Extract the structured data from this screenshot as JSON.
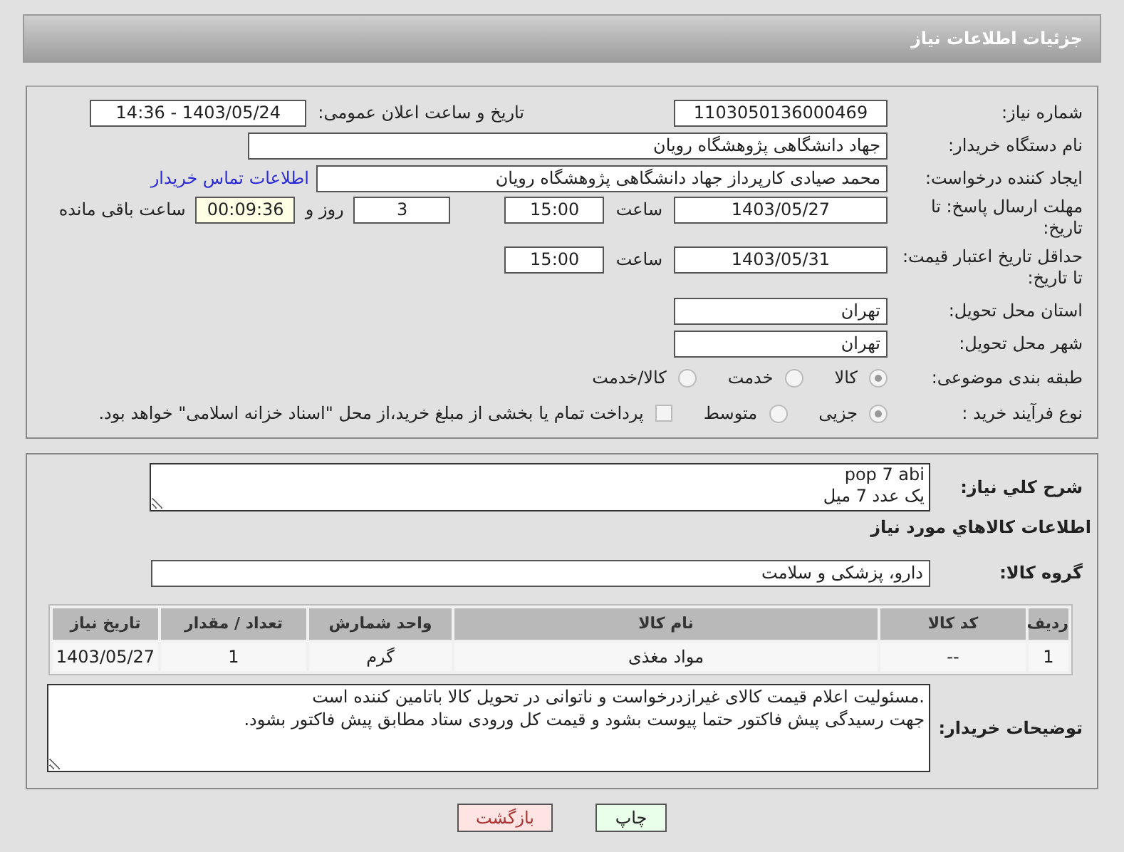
{
  "header": {
    "title": "جزئیات اطلاعات نیاز"
  },
  "need_number": {
    "label": "شماره نیاز:",
    "value": "1103050136000469"
  },
  "announce": {
    "label": "تاریخ و ساعت اعلان عمومی:",
    "value": "1403/05/24 - 14:36"
  },
  "buyer": {
    "label": "نام دستگاه خریدار:",
    "value": "جهاد دانشگاهی پژوهشگاه رویان"
  },
  "requester": {
    "label": "ایجاد کننده درخواست:",
    "value": "محمد صیادی کارپرداز جهاد دانشگاهی پژوهشگاه رویان",
    "link": "اطلاعات تماس خریدار"
  },
  "reply_deadline": {
    "label": "مهلت ارسال پاسخ: تا تاریخ:",
    "date": "1403/05/27",
    "time_label": "ساعت",
    "time": "15:00",
    "days": "3",
    "days_label": "روز و",
    "remaining": "00:09:36",
    "remaining_label": "ساعت باقی مانده"
  },
  "price_validity": {
    "label": "حداقل تاریخ اعتبار قیمت: تا تاریخ:",
    "date": "1403/05/31",
    "time_label": "ساعت",
    "time": "15:00"
  },
  "province": {
    "label": "استان محل تحویل:",
    "value": "تهران"
  },
  "city": {
    "label": "شهر محل تحویل:",
    "value": "تهران"
  },
  "category": {
    "label": "طبقه بندی موضوعی:",
    "options": [
      {
        "label": "کالا",
        "selected": true
      },
      {
        "label": "خدمت",
        "selected": false
      },
      {
        "label": "کالا/خدمت",
        "selected": false
      }
    ]
  },
  "purchase_type": {
    "label": "نوع فرآیند خرید :",
    "options": [
      {
        "kind": "radio",
        "label": "جزیی",
        "selected": true
      },
      {
        "kind": "radio",
        "label": "متوسط",
        "selected": false
      },
      {
        "kind": "checkbox",
        "label": "پرداخت تمام یا بخشی از مبلغ خرید،از محل \"اسناد خزانه اسلامی\" خواهد بود.",
        "checked": false
      }
    ]
  },
  "description": {
    "label": "شرح کلي نياز:",
    "lines": [
      "pop 7 abi",
      "یک عدد 7 میل"
    ]
  },
  "goods_info_title": "اطلاعات کالاهاي مورد نياز",
  "goods_group": {
    "label": "گروه کالا:",
    "value": "دارو، پزشکی و سلامت"
  },
  "table": {
    "columns": [
      "ردیف",
      "کد کالا",
      "نام کالا",
      "واحد شمارش",
      "تعداد / مقدار",
      "تاریخ نیاز"
    ],
    "rows": [
      [
        "1",
        "--",
        "مواد مغذی",
        "گرم",
        "1",
        "1403/05/27"
      ]
    ]
  },
  "buyer_notes": {
    "label": "توضیحات خریدار:",
    "lines": [
      ".مسئولیت اعلام قیمت کالای غیرازدرخواست و ناتوانی در تحویل کالا باتامین کننده است",
      "جهت رسیدگی پیش فاکتور حتما پیوست بشود و قیمت کل ورودی ستاد مطابق پیش فاکتور بشود."
    ]
  },
  "buttons": [
    {
      "kind": "print",
      "label": "چاپ"
    },
    {
      "kind": "back",
      "label": "بازگشت"
    }
  ]
}
